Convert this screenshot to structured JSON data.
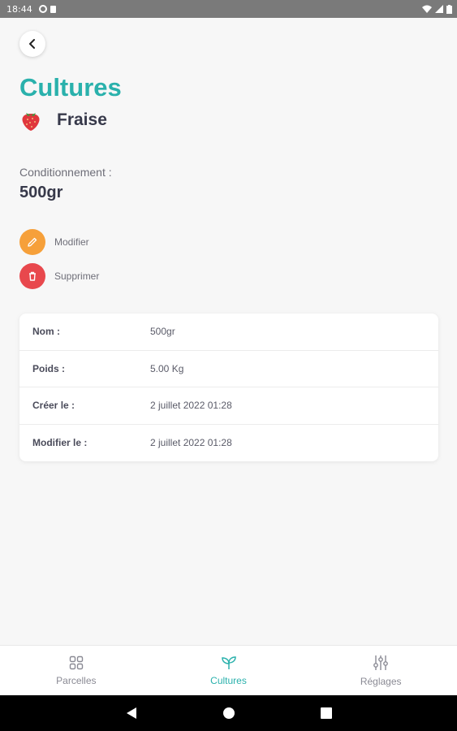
{
  "status_bar": {
    "time": "18:44",
    "icons": [
      "sync-icon",
      "sd-card-icon",
      "wifi-icon",
      "signal-icon",
      "battery-icon"
    ]
  },
  "header": {
    "back_icon": "chevron-left-icon",
    "title": "Cultures",
    "crop_icon": "strawberry-icon",
    "crop_name": "Fraise"
  },
  "packaging": {
    "label": "Conditionnement :",
    "value": "500gr"
  },
  "actions": {
    "edit_label": "Modifier",
    "edit_icon": "pencil-icon",
    "delete_label": "Supprimer",
    "delete_icon": "trash-icon"
  },
  "details": [
    {
      "key": "Nom :",
      "value": "500gr"
    },
    {
      "key": "Poids :",
      "value": "5.00 Kg"
    },
    {
      "key": "Créer le :",
      "value": "2 juillet 2022 01:28"
    },
    {
      "key": "Modifier le :",
      "value": "2 juillet 2022 01:28"
    }
  ],
  "bottom_nav": {
    "items": [
      {
        "label": "Parcelles",
        "icon": "grid-icon",
        "active": false
      },
      {
        "label": "Cultures",
        "icon": "sprout-icon",
        "active": true
      },
      {
        "label": "Réglages",
        "icon": "sliders-icon",
        "active": false
      }
    ]
  },
  "colors": {
    "accent": "#2ab1ac",
    "edit": "#f6a03a",
    "delete": "#e8484d",
    "background": "#f7f7f7"
  }
}
